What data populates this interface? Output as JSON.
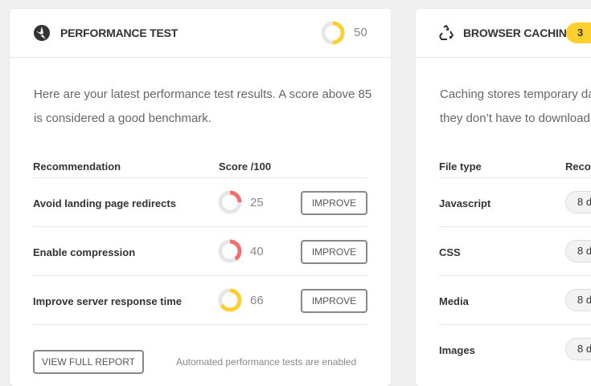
{
  "performance": {
    "title": "Performance Test",
    "overall_score": "50",
    "overall_score_value": 50,
    "description_line1": "Here are your latest performance test results. A score above 85",
    "description_line2": "is considered a good benchmark.",
    "columns": {
      "recommendation": "Recommendation",
      "score": "Score /100"
    },
    "rows": [
      {
        "label": "Avoid landing page redirects",
        "score": "25",
        "score_value": 25,
        "status_color": "#f16f6f",
        "button": "Improve"
      },
      {
        "label": "Enable compression",
        "score": "40",
        "score_value": 40,
        "status_color": "#f16f6f",
        "button": "Improve"
      },
      {
        "label": "Improve server response time",
        "score": "66",
        "score_value": 66,
        "status_color": "#fecf2f",
        "button": "Improve"
      }
    ],
    "report_button": "View Full Report",
    "footnote": "Automated performance tests are enabled"
  },
  "caching": {
    "title": "Browser Caching",
    "badge": "3",
    "description_line1": "Caching stores temporary da",
    "description_line2": "they don’t have to download a",
    "columns": {
      "file_type": "File type",
      "recommended": "Recom"
    },
    "rows": [
      {
        "label": "Javascript",
        "value": "8 d"
      },
      {
        "label": "CSS",
        "value": "8 d"
      },
      {
        "label": "Media",
        "value": "8 d"
      },
      {
        "label": "Images",
        "value": "8 d"
      }
    ]
  },
  "colors": {
    "warning": "#fecf2f",
    "error": "#f16f6f",
    "track": "#e6e6e6"
  },
  "icons": {
    "performance": "gauge-icon",
    "caching": "recycle-icon"
  }
}
